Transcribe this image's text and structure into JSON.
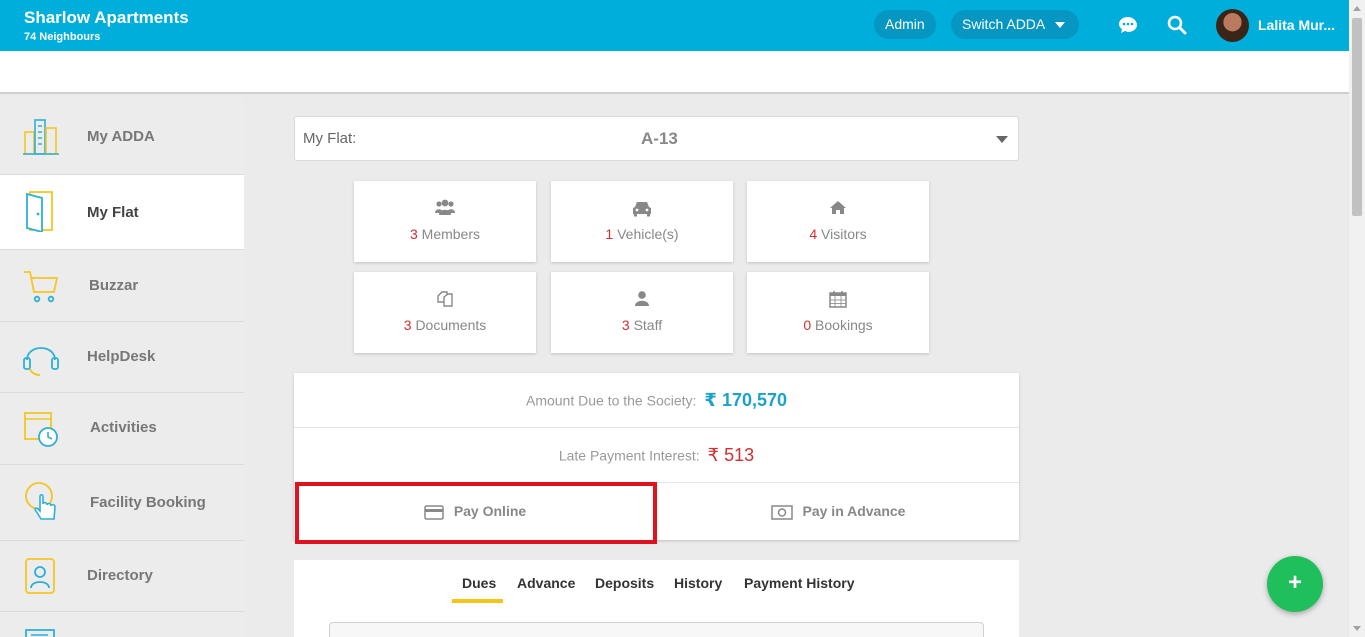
{
  "header": {
    "society_name": "Sharlow Apartments",
    "neighbours": "74 Neighbours",
    "admin_label": "Admin",
    "switch_label": "Switch ADDA",
    "user_name": "Lalita Mur...",
    "accent": "#00aedb"
  },
  "sidebar": {
    "items": [
      {
        "label": "My ADDA",
        "icon": "buildings-icon"
      },
      {
        "label": "My Flat",
        "icon": "door-icon",
        "active": true
      },
      {
        "label": "Buzzar",
        "icon": "cart-icon"
      },
      {
        "label": "HelpDesk",
        "icon": "headset-icon"
      },
      {
        "label": "Activities",
        "icon": "calendar-clock-icon"
      },
      {
        "label": "Facility Booking",
        "icon": "hand-pointer-icon"
      },
      {
        "label": "Directory",
        "icon": "contact-book-icon"
      }
    ]
  },
  "flat_selector": {
    "label": "My Flat:",
    "value": "A-13"
  },
  "tiles": [
    {
      "count": "3",
      "label": "Members",
      "icon": "users-icon"
    },
    {
      "count": "1",
      "label": "Vehicle(s)",
      "icon": "car-icon"
    },
    {
      "count": "4",
      "label": "Visitors",
      "icon": "home-icon"
    },
    {
      "count": "3",
      "label": "Documents",
      "icon": "documents-icon"
    },
    {
      "count": "3",
      "label": "Staff",
      "icon": "person-icon"
    },
    {
      "count": "0",
      "label": "Bookings",
      "icon": "calendar-icon"
    }
  ],
  "dues": {
    "amount_label": "Amount Due to the Society:",
    "amount_value": "₹ 170,570",
    "interest_label": "Late Payment Interest:",
    "interest_value": "₹ 513",
    "pay_online": "Pay Online",
    "pay_advance": "Pay in Advance"
  },
  "tabs": [
    "Dues",
    "Advance",
    "Deposits",
    "History",
    "Payment History"
  ],
  "fab_label": "+"
}
